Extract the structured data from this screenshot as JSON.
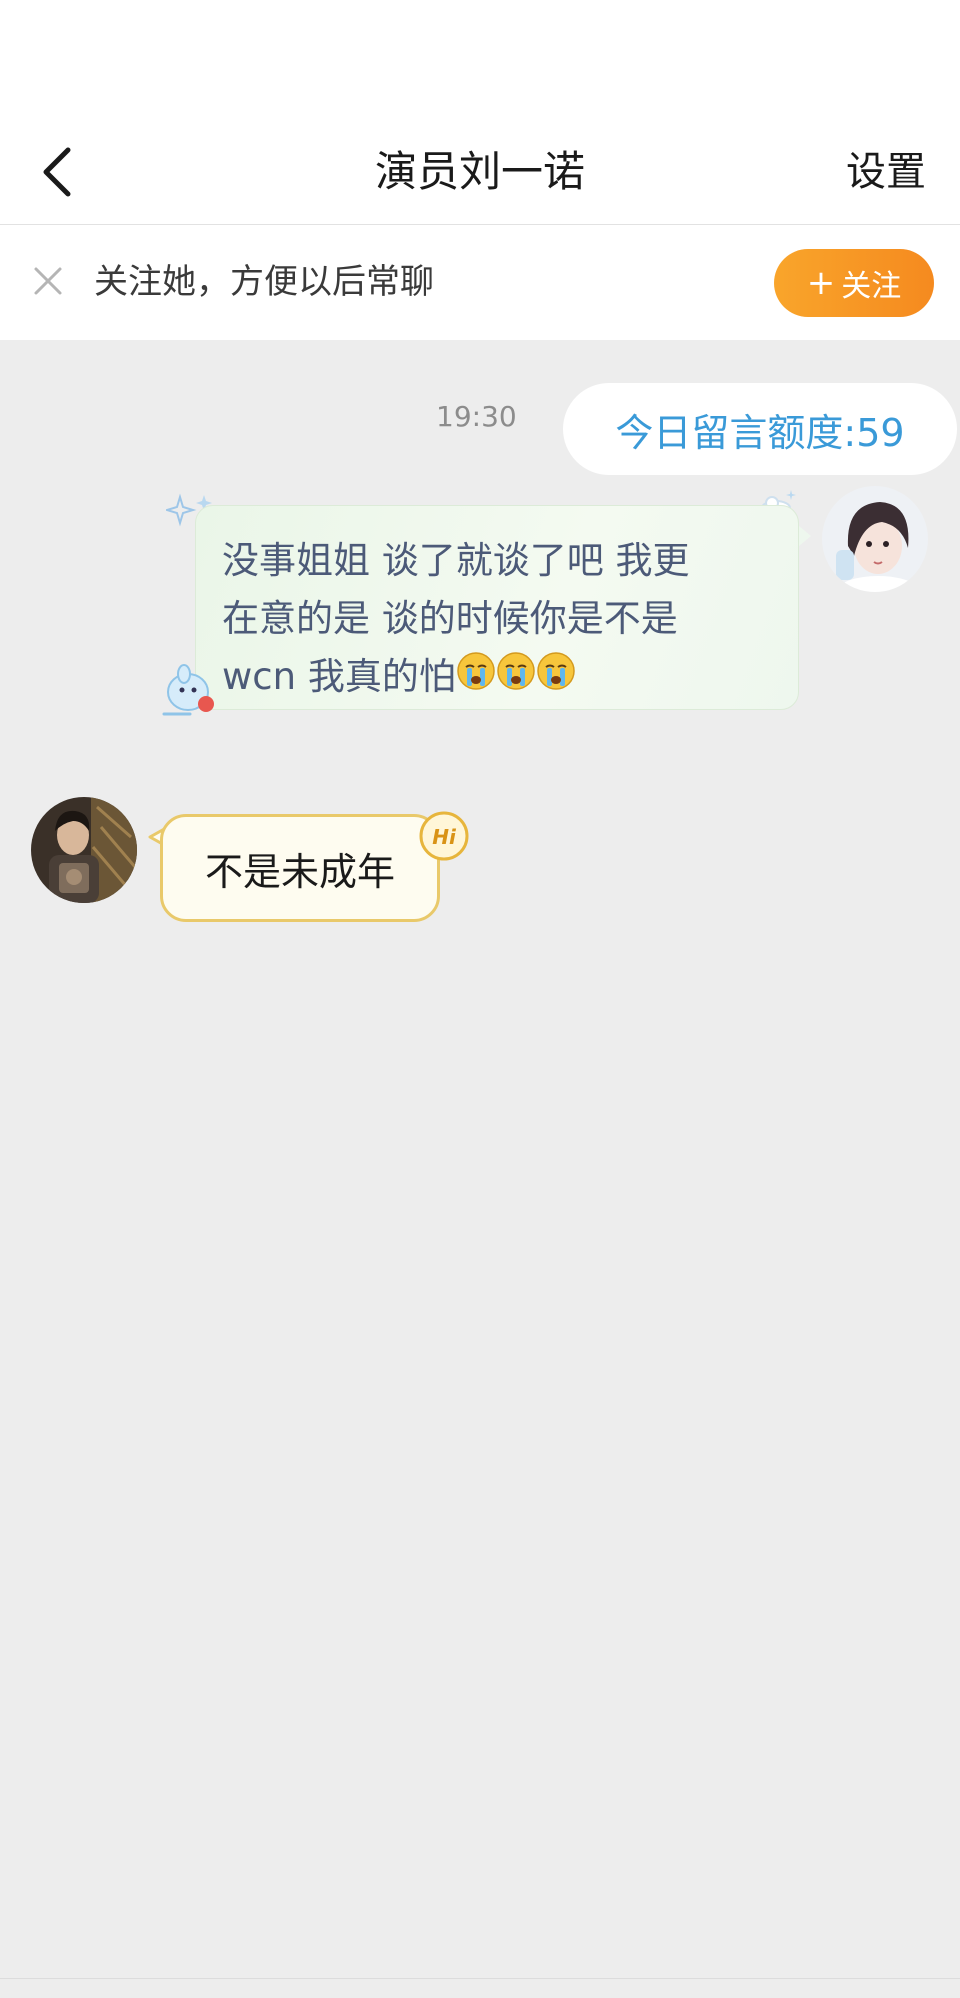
{
  "header": {
    "title": "演员刘一诺",
    "settings_label": "设置",
    "back_icon": "chevron-left-icon"
  },
  "follow_bar": {
    "text": "关注她，方便以后常聊",
    "button_label": "关注",
    "button_plus": "+",
    "close_icon": "close-icon",
    "accent_color": "#f7931e"
  },
  "chat": {
    "timestamp": "19:30",
    "quota_label": "今日留言额度:59",
    "messages": [
      {
        "sender": "self",
        "lines": [
          "没事姐姐 谈了就谈了吧 我更",
          "在意的是 谈的时候你是不是",
          "wcn 我真的怕"
        ],
        "emoji": [
          "😭",
          "😭",
          "😭"
        ]
      },
      {
        "sender": "other",
        "text": "不是未成年",
        "badge": "Hi"
      }
    ]
  },
  "colors": {
    "quota_text": "#3a9ad8",
    "self_bubble_text": "#4c5a78",
    "other_bubble_border": "#e9c96a",
    "background": "#ededed"
  }
}
